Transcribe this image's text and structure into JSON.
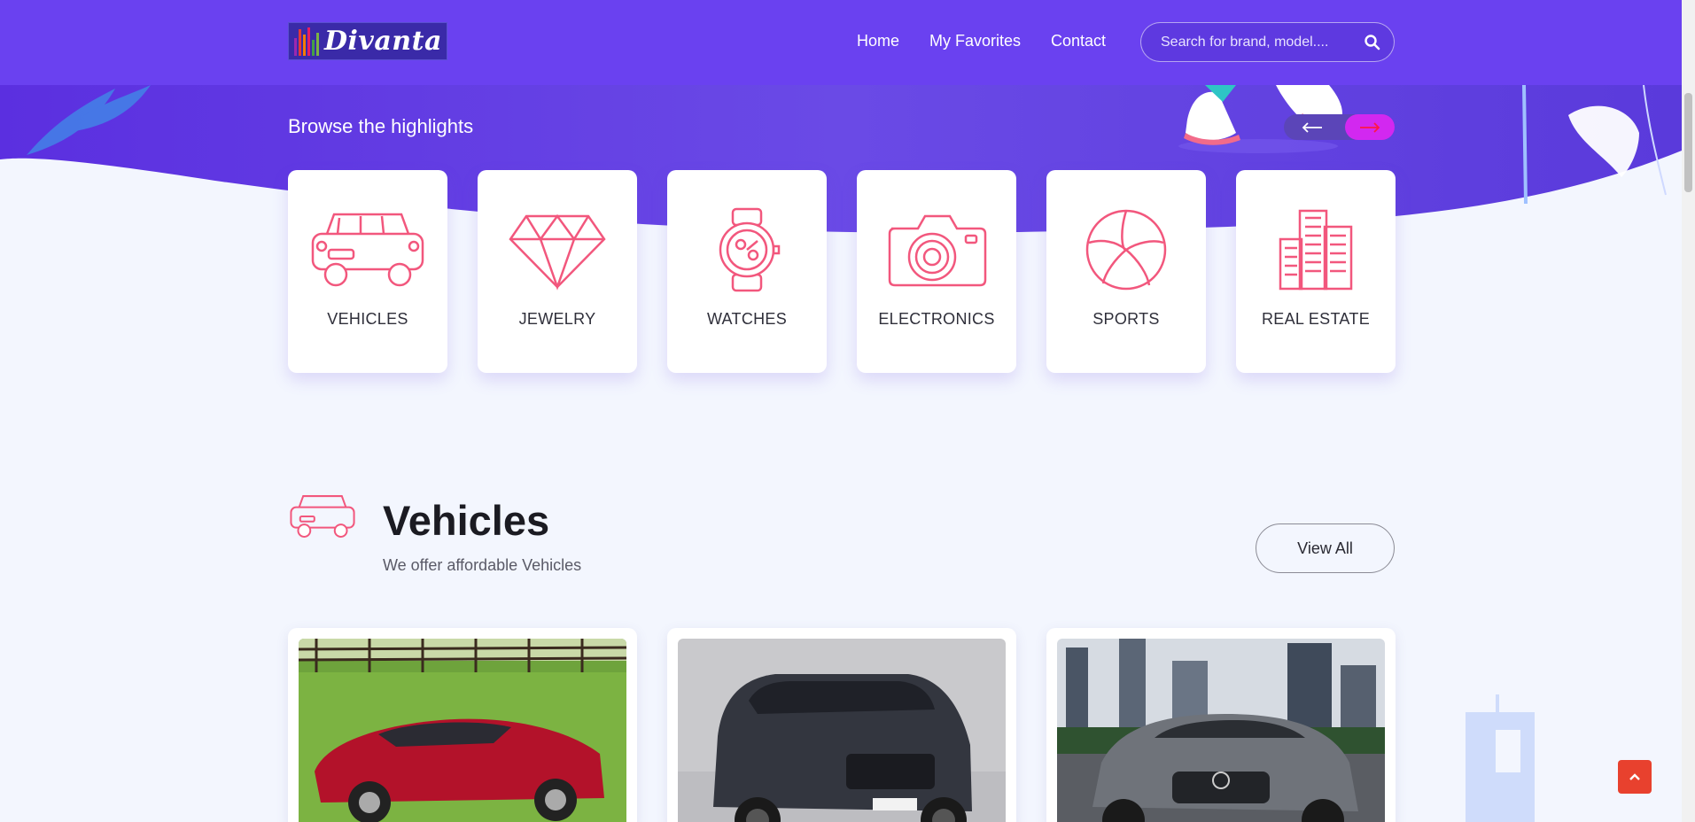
{
  "header": {
    "logo_text": "Divanta",
    "nav": [
      "Home",
      "My Favorites",
      "Contact"
    ],
    "search_placeholder": "Search for brand, model...."
  },
  "highlights": {
    "title": "Browse the highlights",
    "categories": [
      {
        "label": "VEHICLES",
        "icon": "car-icon"
      },
      {
        "label": "JEWELRY",
        "icon": "diamond-icon"
      },
      {
        "label": "WATCHES",
        "icon": "watch-icon"
      },
      {
        "label": "ELECTRONICS",
        "icon": "camera-icon"
      },
      {
        "label": "SPORTS",
        "icon": "volleyball-icon"
      },
      {
        "label": "REAL ESTATE",
        "icon": "buildings-icon"
      }
    ]
  },
  "vehicles": {
    "title": "Vehicles",
    "subtitle": "We offer affordable Vehicles",
    "view_all": "View All",
    "items": [
      {
        "image": "red-sports-coupe-photo"
      },
      {
        "image": "dark-suv-photo"
      },
      {
        "image": "silver-sedan-photo"
      }
    ]
  },
  "colors": {
    "primary": "#6a41f0",
    "accent_pink": "#f2577d",
    "arrow_active": "#d228f0",
    "back_to_top": "#e8412e"
  }
}
